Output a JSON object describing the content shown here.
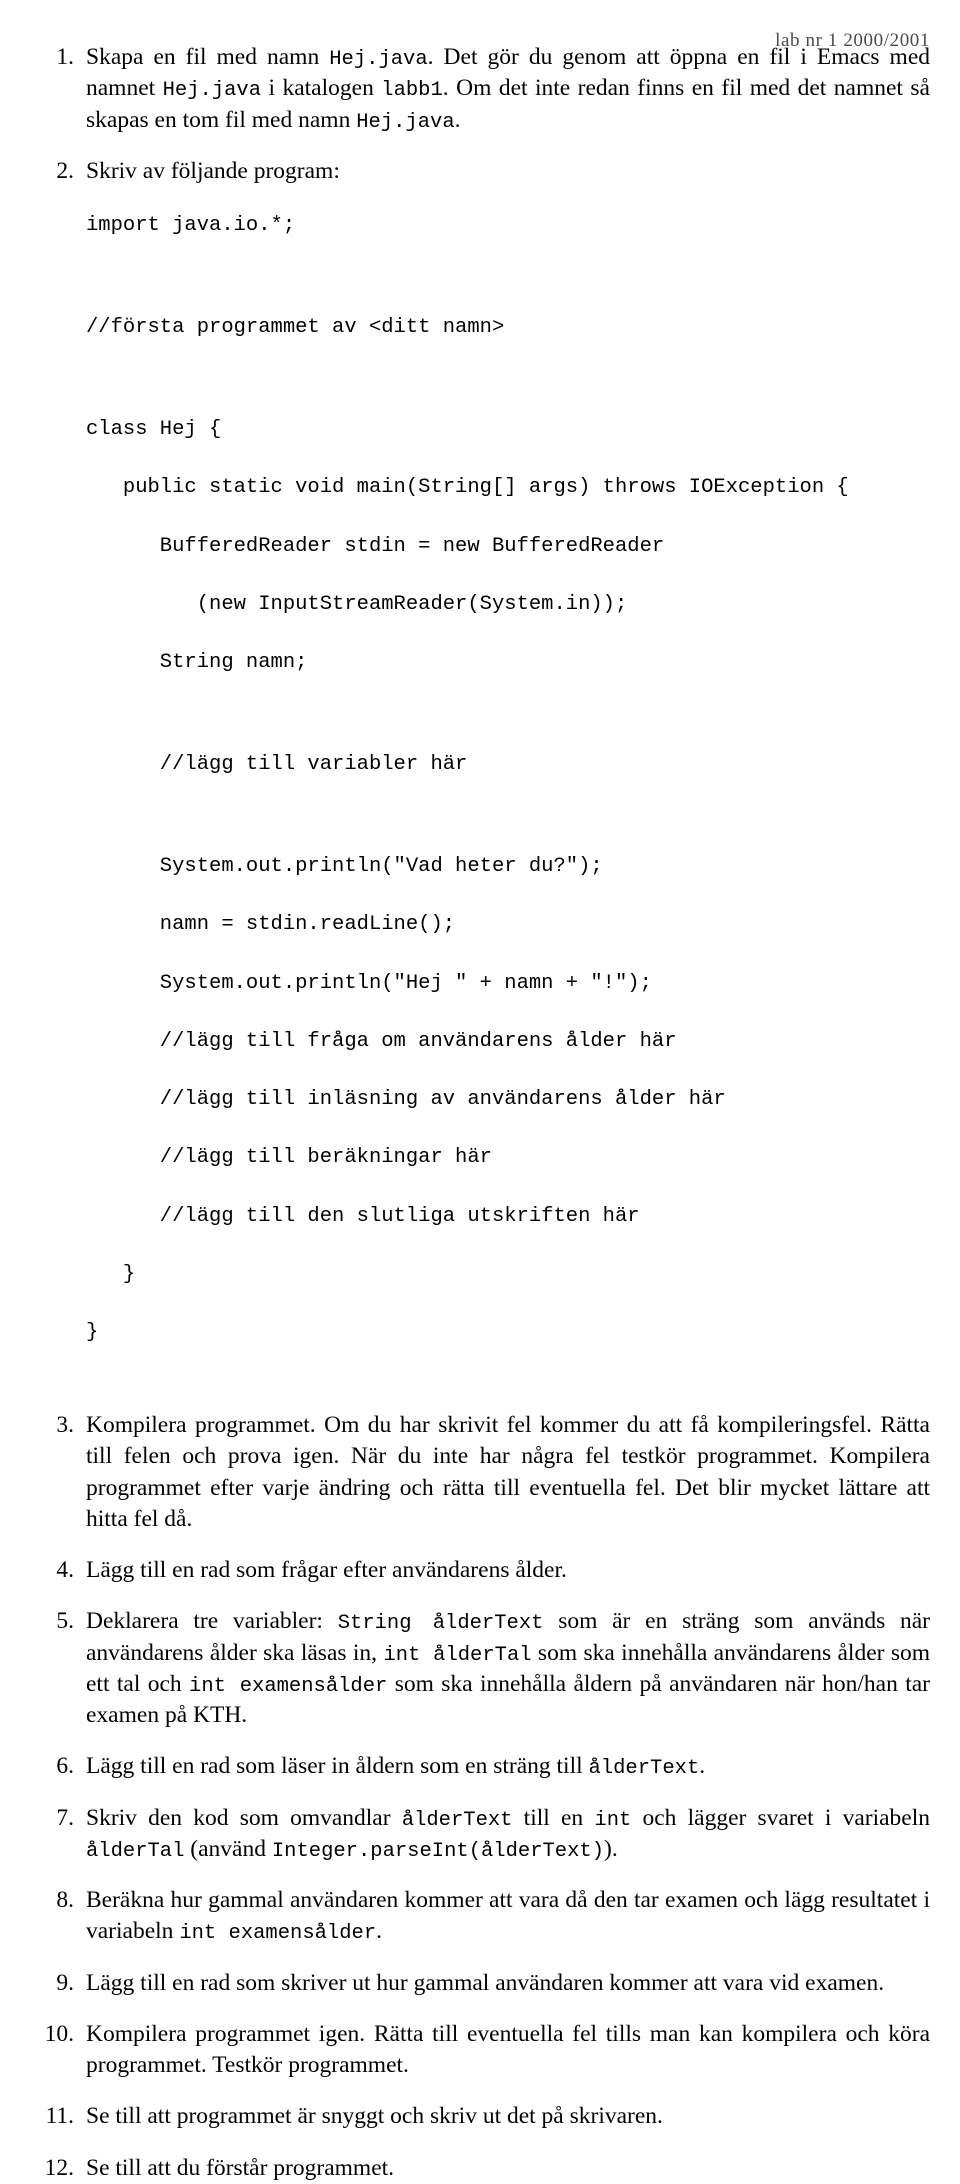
{
  "header": {
    "running_head": "lab nr 1  2000/2001"
  },
  "document": {
    "type": "lab-instructions",
    "language": "sv",
    "steps": [
      {
        "number": "1.",
        "segments": [
          {
            "type": "text",
            "value": "Skapa en fil med namn "
          },
          {
            "type": "code",
            "value": "Hej.java"
          },
          {
            "type": "text",
            "value": ". Det gör du genom att öppna en fil i Emacs med namnet "
          },
          {
            "type": "code",
            "value": "Hej.java"
          },
          {
            "type": "text",
            "value": " i katalogen "
          },
          {
            "type": "code",
            "value": "labb1"
          },
          {
            "type": "text",
            "value": ". Om det inte redan finns en fil med det namnet så skapas en tom fil med namn "
          },
          {
            "type": "code",
            "value": "Hej.java"
          },
          {
            "type": "text",
            "value": "."
          }
        ]
      },
      {
        "number": "2.",
        "segments": [
          {
            "type": "text",
            "value": "Skriv av följande program:"
          }
        ]
      },
      {
        "number": "3.",
        "segments": [
          {
            "type": "text",
            "value": "Kompilera programmet. Om du har skrivit fel kommer du att få kompileringsfel. Rätta till felen och prova igen. När du inte har några fel testkör programmet. Kompilera programmet efter varje ändring och rätta till eventuella fel. Det blir mycket lättare att hitta fel då."
          }
        ]
      },
      {
        "number": "4.",
        "segments": [
          {
            "type": "text",
            "value": "Lägg till en rad som frågar efter användarens ålder."
          }
        ]
      },
      {
        "number": "5.",
        "segments": [
          {
            "type": "text",
            "value": "Deklarera tre variabler: "
          },
          {
            "type": "code",
            "value": "String ålderText"
          },
          {
            "type": "text",
            "value": " som är en sträng som används när användarens ålder ska läsas in, "
          },
          {
            "type": "code",
            "value": "int ålderTal"
          },
          {
            "type": "text",
            "value": " som ska innehålla användarens ålder som ett tal och "
          },
          {
            "type": "code",
            "value": "int examensålder"
          },
          {
            "type": "text",
            "value": " som ska innehålla åldern på användaren när hon/han tar examen på KTH."
          }
        ]
      },
      {
        "number": "6.",
        "segments": [
          {
            "type": "text",
            "value": "Lägg till en rad som läser in åldern som en sträng till "
          },
          {
            "type": "code",
            "value": "ålderText"
          },
          {
            "type": "text",
            "value": "."
          }
        ]
      },
      {
        "number": "7.",
        "segments": [
          {
            "type": "text",
            "value": "Skriv den kod som omvandlar "
          },
          {
            "type": "code",
            "value": "ålderText"
          },
          {
            "type": "text",
            "value": " till en "
          },
          {
            "type": "code",
            "value": "int"
          },
          {
            "type": "text",
            "value": " och lägger svaret i variabeln "
          },
          {
            "type": "code",
            "value": "ålderTal"
          },
          {
            "type": "text",
            "value": " (använd "
          },
          {
            "type": "code",
            "value": "Integer.parseInt(ålderText)"
          },
          {
            "type": "text",
            "value": ")."
          }
        ]
      },
      {
        "number": "8.",
        "segments": [
          {
            "type": "text",
            "value": "Beräkna hur gammal användaren kommer att vara då den tar examen och lägg resultatet i variabeln "
          },
          {
            "type": "code",
            "value": "int examensålder"
          },
          {
            "type": "text",
            "value": "."
          }
        ]
      },
      {
        "number": "9.",
        "segments": [
          {
            "type": "text",
            "value": "Lägg till en rad som skriver ut hur gammal användaren kommer att vara vid examen."
          }
        ]
      },
      {
        "number": "10.",
        "segments": [
          {
            "type": "text",
            "value": "Kompilera programmet igen. Rätta till eventuella fel tills man kan kompilera och köra programmet. Testkör programmet."
          }
        ]
      },
      {
        "number": "11.",
        "segments": [
          {
            "type": "text",
            "value": "Se till att programmet är snyggt och skriv ut det på skrivaren."
          }
        ]
      },
      {
        "number": "12.",
        "segments": [
          {
            "type": "text",
            "value": "Se till att du förstår programmet."
          }
        ]
      }
    ],
    "code_listing": {
      "language": "java",
      "lines": [
        "import java.io.*;",
        "",
        "//första programmet av <ditt namn>",
        "",
        "class Hej {",
        "   public static void main(String[] args) throws IOException {",
        "      BufferedReader stdin = new BufferedReader",
        "         (new InputStreamReader(System.in));",
        "      String namn;",
        "",
        "      //lägg till variabler här",
        "",
        "      System.out.println(\"Vad heter du?\");",
        "      namn = stdin.readLine();",
        "      System.out.println(\"Hej \" + namn + \"!\");",
        "      //lägg till fråga om användarens ålder här",
        "      //lägg till inläsning av användarens ålder här",
        "      //lägg till beräkningar här",
        "      //lägg till den slutliga utskriften här",
        "   }",
        "}"
      ]
    }
  }
}
